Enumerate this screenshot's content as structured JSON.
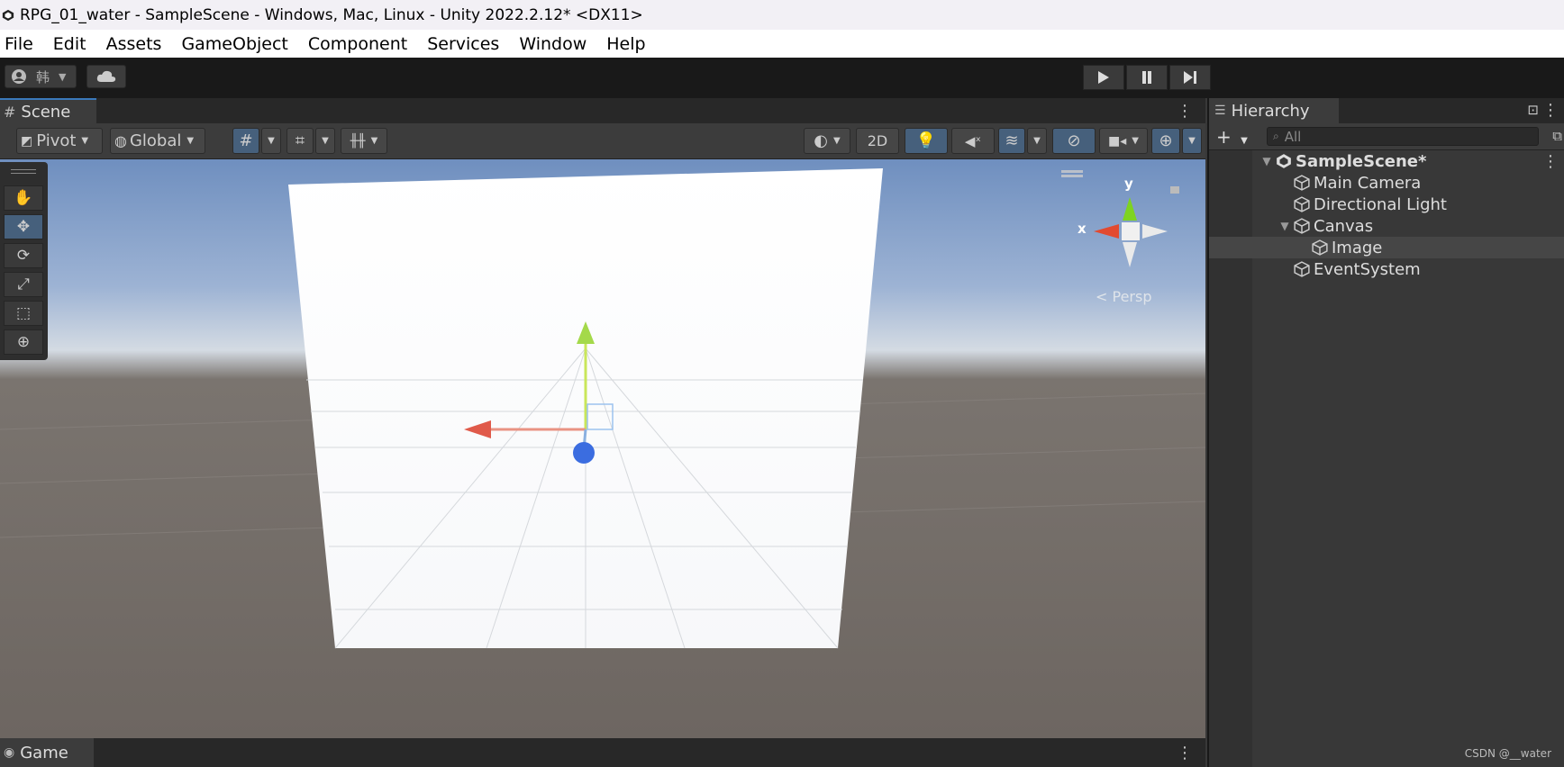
{
  "window": {
    "title": "RPG_01_water - SampleScene - Windows, Mac, Linux - Unity 2022.2.12* <DX11>"
  },
  "menu": {
    "items": [
      "File",
      "Edit",
      "Assets",
      "GameObject",
      "Component",
      "Services",
      "Window",
      "Help"
    ]
  },
  "toolbar": {
    "account_label": "韩"
  },
  "scene_panel": {
    "tab_label": "Scene",
    "pivot_label": "Pivot",
    "global_label": "Global",
    "mode_2d_label": "2D",
    "persp_label": "Persp",
    "gizmo_y": "y",
    "gizmo_x": "x"
  },
  "game_panel": {
    "tab_label": "Game"
  },
  "hierarchy": {
    "tab_label": "Hierarchy",
    "search_placeholder": "All",
    "items": [
      {
        "label": "SampleScene*",
        "depth": 0,
        "expanded": true
      },
      {
        "label": "Main Camera",
        "depth": 1
      },
      {
        "label": "Directional Light",
        "depth": 1
      },
      {
        "label": "Canvas",
        "depth": 1,
        "expanded": true
      },
      {
        "label": "Image",
        "depth": 2,
        "selected": true
      },
      {
        "label": "EventSystem",
        "depth": 1
      }
    ]
  },
  "watermark": "CSDN @__water",
  "colors": {
    "accent": "#3a79bb",
    "selected_tool": "#46607c",
    "gizmo_x": "#e05a4a",
    "gizmo_y": "#a4d94a",
    "gizmo_z": "#3b6de0"
  }
}
